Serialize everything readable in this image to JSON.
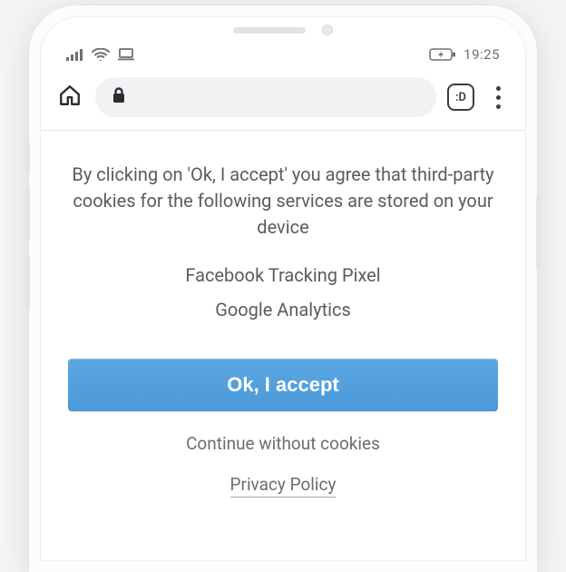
{
  "status": {
    "time": "19:25"
  },
  "browser": {
    "tabs_label": ":D"
  },
  "consent": {
    "intro": "By clicking on 'Ok, I accept' you agree that third-party cookies for the following services are stored on your device",
    "services": [
      "Facebook Tracking Pixel",
      "Google Analytics"
    ],
    "accept_label": "Ok, I accept",
    "continue_label": "Continue without cookies",
    "policy_label": "Privacy Policy"
  },
  "colors": {
    "accent": "#4b99d8",
    "text": "#595c61"
  }
}
